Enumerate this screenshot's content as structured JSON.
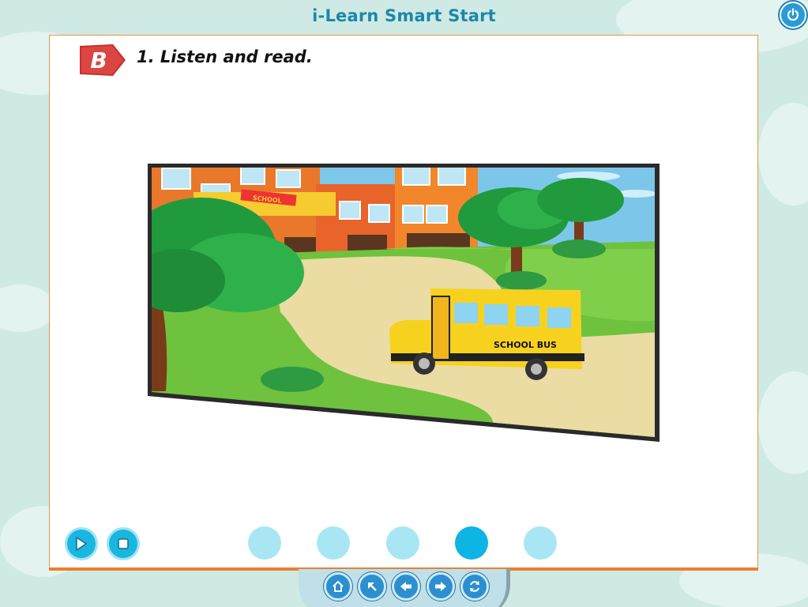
{
  "app": {
    "title": "i-Learn Smart Start",
    "power_icon": "power-icon"
  },
  "lesson": {
    "section_letter": "B",
    "instruction": "1. Listen and read."
  },
  "scene": {
    "school_sign": "SCHOOL",
    "bus_label": "SCHOOL BUS"
  },
  "controls": {
    "play_icon": "play-icon",
    "stop_icon": "stop-icon"
  },
  "pager": {
    "total": 5,
    "active_index": 3
  },
  "nav": [
    {
      "name": "home",
      "icon": "home-icon"
    },
    {
      "name": "back-to-menu",
      "icon": "arrow-up-left-icon"
    },
    {
      "name": "previous",
      "icon": "arrow-left-icon"
    },
    {
      "name": "next",
      "icon": "arrow-right-icon"
    },
    {
      "name": "refresh",
      "icon": "refresh-icon"
    }
  ],
  "colors": {
    "accent": "#19b6e0",
    "badge": "#d43a3a",
    "panel_border": "#ee7f2d",
    "title": "#1b88a8"
  }
}
